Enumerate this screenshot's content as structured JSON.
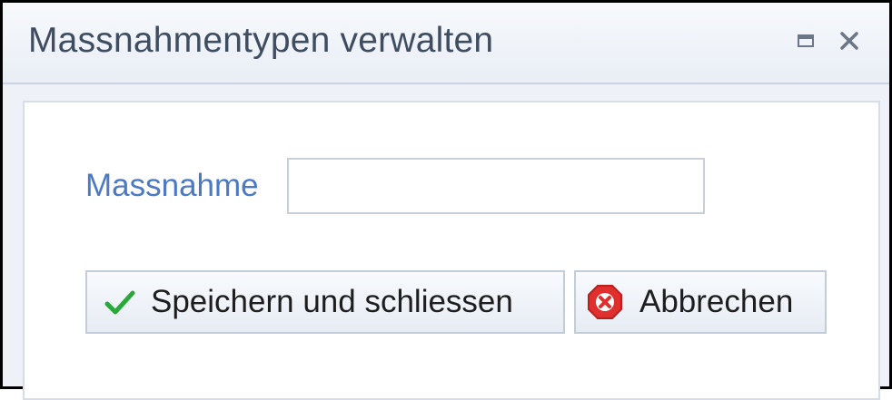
{
  "window": {
    "title": "Massnahmentypen verwalten",
    "controls": {
      "maximize_icon": "maximize-icon",
      "close_icon": "close-icon"
    }
  },
  "form": {
    "massnahme_label": "Massnahme",
    "massnahme_value": "",
    "massnahme_placeholder": ""
  },
  "actions": {
    "save_label": "Speichern und schliessen",
    "save_icon": "checkmark-icon",
    "cancel_label": "Abbrechen",
    "cancel_icon": "cancel-icon"
  },
  "colors": {
    "title_text": "#3f4d61",
    "label_text": "#4a7ac4",
    "checkmark_green": "#2aa83a",
    "cancel_red": "#e0302e"
  }
}
